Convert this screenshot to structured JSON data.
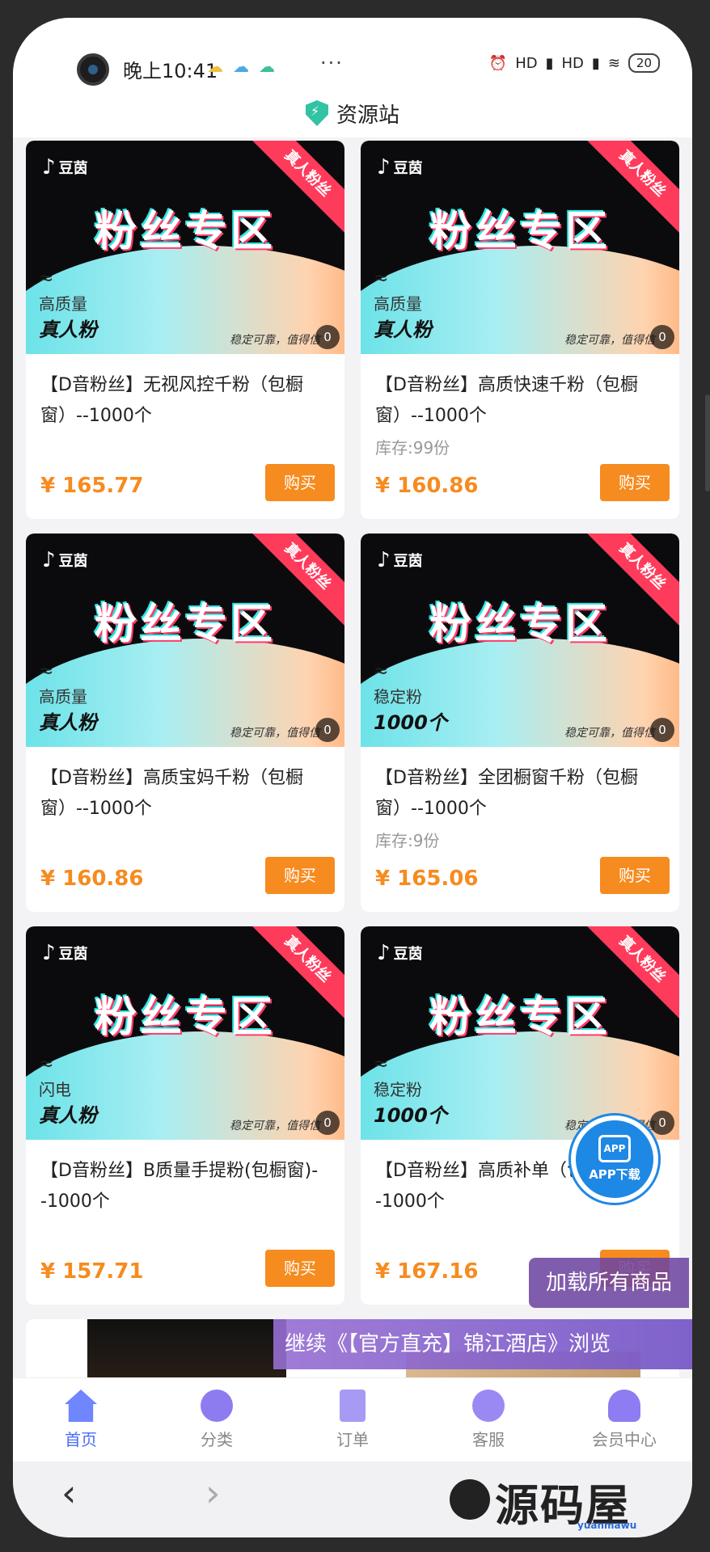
{
  "status": {
    "time": "晚上10:41",
    "dots": "···",
    "signal1": "HD",
    "signal2": "HD",
    "battery": "20"
  },
  "header": {
    "title": "资源站"
  },
  "banner": {
    "brand": "豆茵",
    "headline": "粉丝专区",
    "ribbon": "真人粉丝",
    "wave": "≈",
    "slogan": "稳定可靠，值得信",
    "counter": "0"
  },
  "products": [
    {
      "tag1": "高质量",
      "tag2": "真人粉",
      "name": "【D音粉丝】无视风控千粉（包橱窗）--1000个",
      "stock": "",
      "price": "¥ 165.77",
      "buy": "购买"
    },
    {
      "tag1": "高质量",
      "tag2": "真人粉",
      "name": "【D音粉丝】高质快速千粉（包橱窗）--1000个",
      "stock": "库存:99份",
      "price": "¥ 160.86",
      "buy": "购买"
    },
    {
      "tag1": "高质量",
      "tag2": "真人粉",
      "name": "【D音粉丝】高质宝妈千粉（包橱窗）--1000个",
      "stock": "",
      "price": "¥ 160.86",
      "buy": "购买"
    },
    {
      "tag1": "稳定粉",
      "tag2": "1000个",
      "name": "【D音粉丝】全团橱窗千粉（包橱窗）--1000个",
      "stock": "库存:9份",
      "price": "¥ 165.06",
      "buy": "购买"
    },
    {
      "tag1": "闪电",
      "tag2": "真人粉",
      "name": "【D音粉丝】B质量手提粉(包橱窗)--1000个",
      "stock": "",
      "price": "¥ 157.71",
      "buy": "购买"
    },
    {
      "tag1": "稳定粉",
      "tag2": "1000个",
      "name": "【D音粉丝】高质补单（包橱窗）--1000个",
      "stock": "",
      "price": "¥ 167.16",
      "buy": "购买"
    }
  ],
  "floating": {
    "load_all": "加载所有商品",
    "continue": "继续《【官方直充】锦江酒店》浏览",
    "app_box": "APP",
    "app_label": "APP下载"
  },
  "tabs": [
    {
      "label": "首页"
    },
    {
      "label": "分类"
    },
    {
      "label": "订单"
    },
    {
      "label": "客服"
    },
    {
      "label": "会员中心"
    }
  ],
  "nav": {
    "back": "‹",
    "forward": "›"
  },
  "watermark": {
    "text": "源码屋",
    "sub": "yuanmawu"
  }
}
